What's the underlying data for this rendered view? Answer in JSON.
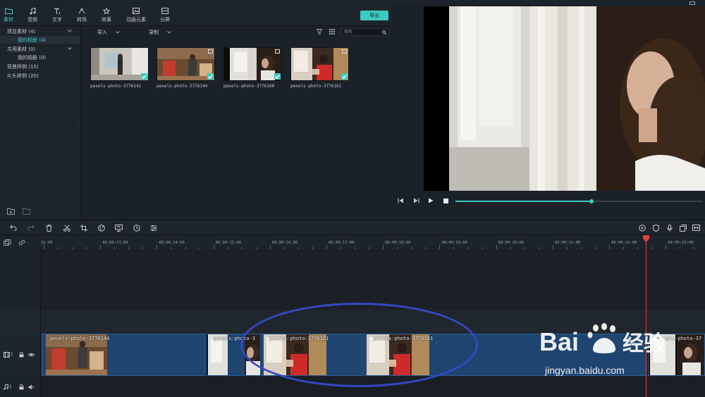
{
  "library": {
    "tabs": [
      {
        "label": "素材",
        "icon": "folder-icon",
        "active": true
      },
      {
        "label": "音频",
        "icon": "music-icon"
      },
      {
        "label": "文字",
        "icon": "text-icon"
      },
      {
        "label": "转场",
        "icon": "transition-icon"
      },
      {
        "label": "效果",
        "icon": "effects-icon"
      },
      {
        "label": "动画元素",
        "icon": "image-icon"
      },
      {
        "label": "分屏",
        "icon": "split-screen-icon"
      }
    ],
    "export_label": "导出",
    "sidebar": [
      {
        "label": "项目素材 (4)",
        "expandable": true
      },
      {
        "label": "我的相册 (4)",
        "active": true
      },
      {
        "label": "共用素材 (0)",
        "expandable": true
      },
      {
        "label": "我的相册 (0)"
      },
      {
        "label": "背景样例 (15)"
      },
      {
        "label": "片头样例 (20)"
      }
    ],
    "import_label": "导入",
    "record_label": "录制",
    "search_placeholder": "搜索",
    "media": [
      {
        "name": "pexels-photo-3776141"
      },
      {
        "name": "pexels-photo-3776144"
      },
      {
        "name": "pexels-photo-3776160"
      },
      {
        "name": "pexels-photo-3776161"
      }
    ]
  },
  "player": {
    "progress": 0.55
  },
  "ruler": {
    "ticks": [
      "12:00",
      "00:00:13:00",
      "00:00:14:00",
      "00:00:15:00",
      "00:00:16:00",
      "00:00:17:00",
      "00:00:18:00",
      "00:00:19:00",
      "00:00:20:00",
      "00:00:21:00",
      "00:00:22:00",
      "00:00:23:00"
    ]
  },
  "tracks": {
    "video_track_num": "1",
    "audio_track_num": "1"
  },
  "clips": [
    {
      "label": "pexels-photo-3776144"
    },
    {
      "label": "pexels-photo-3"
    },
    {
      "label": "pexels-photo-3776161"
    },
    {
      "label": "pexels-photo-3776161"
    },
    {
      "label": "pexels-photo-37"
    }
  ],
  "watermark": {
    "logo": "Bai 经验",
    "url": "jingyan.baidu.com"
  },
  "colors": {
    "accent": "#3ccbc0",
    "clip_blue": "#1f4470",
    "playhead": "#e0433b",
    "annotation": "#3548c4"
  }
}
